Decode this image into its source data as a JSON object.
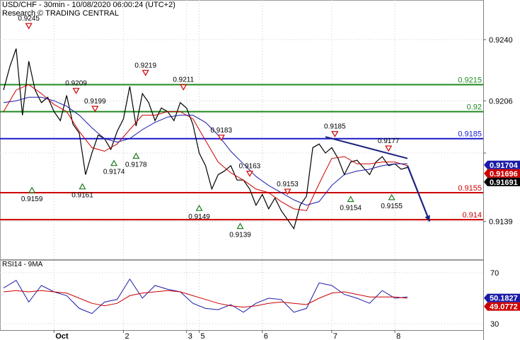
{
  "header": {
    "title": "USD/CHF - 30min - 10/08/2020 06:00:24 (UTC+2)",
    "source": "Research © TRADING CENTRAL"
  },
  "colors": {
    "price": "#000000",
    "ma_fast": "#cc0000",
    "ma_slow": "#1a1aa8",
    "resistance": "#1f8a1f",
    "pivot": "#1a1acc",
    "support": "#cc0000",
    "trend": "#1a237e",
    "up_marker": "#1f7a1f",
    "down_marker": "#cc0000",
    "rsi": "#1a1aa8",
    "rsi_ma": "#cc0000",
    "grid": "#c8c8c8"
  },
  "chart_data": [
    {
      "type": "line",
      "title": "USD/CHF - 30min - 10/08/2020 06:00:24 (UTC+2)",
      "ylim": [
        0.9118,
        0.9262
      ],
      "y_ticks": [
        0.924,
        0.9206,
        0.9139,
        0.9177
      ],
      "y_tick_labels": [
        "0.9240",
        "0.9206",
        "0.9139",
        ""
      ],
      "x_tick_labels": [
        "Oct",
        "2",
        "3",
        "5",
        "6",
        "7",
        "8"
      ],
      "x_tick_positions": [
        8,
        19,
        29,
        31,
        41,
        52,
        62
      ],
      "x_range": [
        0,
        76
      ],
      "series": [
        {
          "key": "price",
          "x": [
            0,
            1,
            2,
            3,
            4,
            5,
            6,
            7,
            8,
            9,
            10,
            11,
            12,
            13,
            14,
            15,
            16,
            17,
            18,
            19,
            20,
            21,
            22,
            23,
            24,
            25,
            26,
            27,
            28,
            29,
            30,
            31,
            32,
            33,
            34,
            35,
            36,
            37,
            38,
            39,
            40,
            41,
            42,
            43,
            44,
            45,
            46,
            47,
            48,
            49,
            50,
            51,
            52,
            53,
            54,
            55,
            56,
            57,
            58,
            59,
            60,
            61,
            62,
            63,
            64
          ],
          "values": [
            0.9212,
            0.9225,
            0.9235,
            0.9198,
            0.9228,
            0.9212,
            0.9205,
            0.9208,
            0.92,
            0.9195,
            0.9209,
            0.9193,
            0.9188,
            0.9165,
            0.9177,
            0.9187,
            0.9185,
            0.9179,
            0.9189,
            0.9196,
            0.9214,
            0.9192,
            0.921,
            0.9205,
            0.9195,
            0.9202,
            0.92,
            0.9195,
            0.9205,
            0.9202,
            0.9193,
            0.9177,
            0.917,
            0.9157,
            0.9165,
            0.9167,
            0.917,
            0.9162,
            0.9162,
            0.9157,
            0.9148,
            0.9154,
            0.9146,
            0.9152,
            0.9145,
            0.914,
            0.9135,
            0.9148,
            0.9153,
            0.918,
            0.9182,
            0.9177,
            0.918,
            0.9174,
            0.9165,
            0.9172,
            0.9173,
            0.9169,
            0.9165,
            0.9172,
            0.9175,
            0.917,
            0.9171,
            0.9168,
            0.9169
          ]
        },
        {
          "key": "ma_fast",
          "x": [
            0,
            2,
            4,
            6,
            8,
            10,
            12,
            14,
            16,
            18,
            20,
            22,
            24,
            26,
            28,
            30,
            32,
            34,
            36,
            38,
            40,
            42,
            44,
            46,
            48,
            50,
            52,
            54,
            56,
            58,
            60,
            62,
            64
          ],
          "values": [
            0.92,
            0.9212,
            0.9215,
            0.921,
            0.9204,
            0.92,
            0.9189,
            0.918,
            0.9178,
            0.9182,
            0.919,
            0.9198,
            0.9198,
            0.92,
            0.92,
            0.9196,
            0.9184,
            0.9172,
            0.9166,
            0.9162,
            0.9157,
            0.9155,
            0.915,
            0.9146,
            0.9145,
            0.916,
            0.9174,
            0.9175,
            0.9171,
            0.9171,
            0.9172,
            0.9172,
            0.917
          ]
        },
        {
          "key": "ma_slow",
          "x": [
            0,
            2,
            4,
            6,
            8,
            10,
            12,
            14,
            16,
            18,
            20,
            22,
            24,
            26,
            28,
            30,
            32,
            34,
            36,
            38,
            40,
            42,
            44,
            46,
            48,
            50,
            52,
            54,
            56,
            58,
            60,
            62,
            64
          ],
          "values": [
            0.9205,
            0.9206,
            0.9208,
            0.9208,
            0.9206,
            0.9203,
            0.9198,
            0.9191,
            0.9185,
            0.9183,
            0.9185,
            0.919,
            0.9194,
            0.9197,
            0.9198,
            0.9198,
            0.9194,
            0.9187,
            0.9178,
            0.9171,
            0.9164,
            0.9159,
            0.9155,
            0.9151,
            0.9148,
            0.915,
            0.9159,
            0.9165,
            0.9167,
            0.9168,
            0.917,
            0.9171,
            0.9171
          ]
        },
        {
          "key": "forecast",
          "x": [
            64,
            67.5
          ],
          "values": [
            0.917,
            0.9139
          ]
        }
      ],
      "levels": [
        {
          "name": "resistance",
          "value": 0.9215,
          "label": "0.9215"
        },
        {
          "name": "resistance",
          "value": 0.92,
          "label": "0.92"
        },
        {
          "name": "pivot",
          "value": 0.9185,
          "label": "0.9185"
        },
        {
          "name": "support",
          "value": 0.9155,
          "label": "0.9155"
        },
        {
          "name": "support",
          "value": 0.914,
          "label": "0.914"
        }
      ],
      "trendline": {
        "x": [
          51,
          64
        ],
        "values": [
          0.9186,
          0.9174
        ]
      },
      "annotations": [
        {
          "text": "0.9245",
          "x": 4,
          "value": 0.9245,
          "kind": "high"
        },
        {
          "text": "0.9209",
          "x": 11.5,
          "value": 0.9209,
          "kind": "high"
        },
        {
          "text": "0.9199",
          "x": 14.5,
          "value": 0.9199,
          "kind": "high"
        },
        {
          "text": "0.9219",
          "x": 22.5,
          "value": 0.9219,
          "kind": "high"
        },
        {
          "text": "0.9211",
          "x": 28.5,
          "value": 0.9211,
          "kind": "high"
        },
        {
          "text": "0.9183",
          "x": 34.5,
          "value": 0.9183,
          "kind": "high"
        },
        {
          "text": "0.9163",
          "x": 39,
          "value": 0.9163,
          "kind": "high"
        },
        {
          "text": "0.9153",
          "x": 45,
          "value": 0.9153,
          "kind": "high"
        },
        {
          "text": "0.9185",
          "x": 52.5,
          "value": 0.9185,
          "kind": "high"
        },
        {
          "text": "0.9177",
          "x": 61,
          "value": 0.9177,
          "kind": "high"
        },
        {
          "text": "0.9159",
          "x": 4.5,
          "value": 0.9159,
          "kind": "low"
        },
        {
          "text": "0.9161",
          "x": 12.5,
          "value": 0.9161,
          "kind": "low"
        },
        {
          "text": "0.9174",
          "x": 17.5,
          "value": 0.9174,
          "kind": "low"
        },
        {
          "text": "0.9178",
          "x": 21,
          "value": 0.9178,
          "kind": "low"
        },
        {
          "text": "0.9149",
          "x": 31,
          "value": 0.9149,
          "kind": "low"
        },
        {
          "text": "0.9139",
          "x": 37.5,
          "value": 0.9139,
          "kind": "low"
        },
        {
          "text": "0.9154",
          "x": 55,
          "value": 0.9154,
          "kind": "low"
        },
        {
          "text": "0.9155",
          "x": 61.5,
          "value": 0.9155,
          "kind": "low"
        }
      ],
      "value_tags": [
        {
          "text": "0.91704",
          "value": 0.91704,
          "color": "#1a1aa8"
        },
        {
          "text": "0.91696",
          "value": 0.91696,
          "color": "#cc0000"
        },
        {
          "text": "0.91691",
          "value": 0.91691,
          "color": "#000000"
        }
      ]
    },
    {
      "type": "line",
      "title": "RSI14 - 9MA",
      "ylim": [
        25,
        80
      ],
      "y_ticks": [
        70,
        30
      ],
      "series": [
        {
          "key": "rsi",
          "x": [
            0,
            2,
            4,
            6,
            8,
            10,
            12,
            14,
            16,
            18,
            20,
            22,
            24,
            26,
            28,
            30,
            32,
            34,
            36,
            38,
            40,
            42,
            44,
            46,
            48,
            50,
            52,
            54,
            56,
            58,
            60,
            62,
            64
          ],
          "values": [
            58,
            64,
            47,
            60,
            55,
            52,
            42,
            38,
            47,
            49,
            65,
            50,
            60,
            57,
            55,
            46,
            42,
            41,
            45,
            39,
            46,
            50,
            49,
            39,
            42,
            62,
            60,
            53,
            50,
            46,
            56,
            50,
            51
          ]
        },
        {
          "key": "rsi_ma",
          "x": [
            0,
            2,
            4,
            6,
            8,
            10,
            12,
            14,
            16,
            18,
            20,
            22,
            24,
            26,
            28,
            30,
            32,
            34,
            36,
            38,
            40,
            42,
            44,
            46,
            48,
            50,
            52,
            54,
            56,
            58,
            60,
            62,
            64
          ],
          "values": [
            55,
            56,
            55,
            56,
            55,
            54,
            50,
            46,
            44,
            46,
            52,
            54,
            55,
            56,
            55,
            52,
            49,
            46,
            44,
            43,
            44,
            46,
            47,
            46,
            45,
            50,
            54,
            55,
            53,
            51,
            51,
            51,
            50
          ]
        }
      ],
      "value_tags": [
        {
          "text": "50.1827",
          "value": 50.1827,
          "color": "#1a1aa8"
        },
        {
          "text": "49.0772",
          "value": 49.0772,
          "color": "#cc0000"
        }
      ]
    }
  ]
}
